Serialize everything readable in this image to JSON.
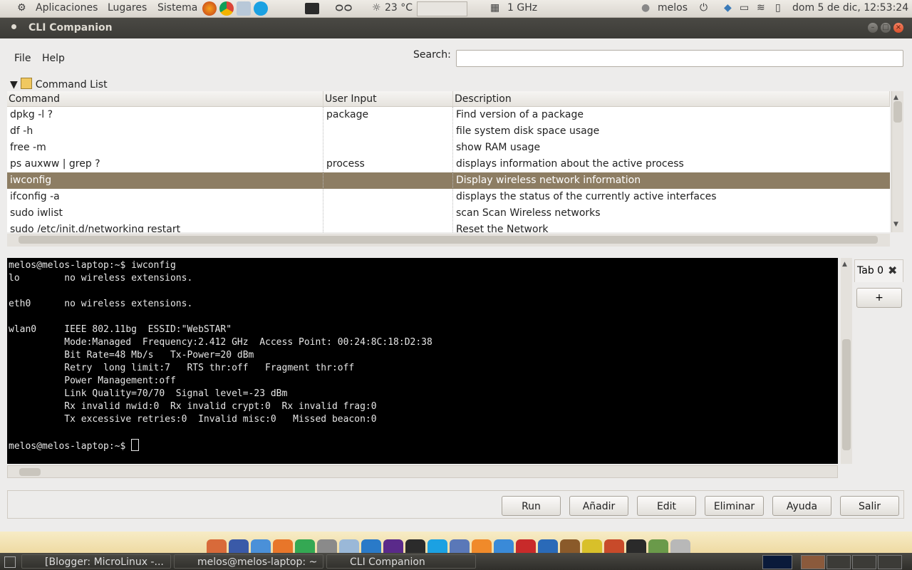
{
  "top_panel": {
    "menus": [
      "Aplicaciones",
      "Lugares",
      "Sistema"
    ],
    "weather": "23 °C",
    "cpu_freq": "1 GHz",
    "user": "melos",
    "datetime": "dom  5 de dic, 12:53:24"
  },
  "window": {
    "title": "CLI Companion",
    "menu": [
      "File",
      "Help"
    ],
    "search": {
      "label": "Search:",
      "value": ""
    },
    "command_list_label": "Command List",
    "table": {
      "headers": [
        "Command",
        "User Input",
        "Description"
      ],
      "rows": [
        {
          "command": "dpkg -l ?",
          "input": "package",
          "description": "Find version of a package"
        },
        {
          "command": "df -h",
          "input": "",
          "description": "file system disk space usage"
        },
        {
          "command": "free -m",
          "input": "",
          "description": "show RAM usage"
        },
        {
          "command": "ps auxww | grep ?",
          "input": "process",
          "description": "displays information about the active process"
        },
        {
          "command": "iwconfig",
          "input": "",
          "description": "Display wireless network information"
        },
        {
          "command": "ifconfig -a",
          "input": "",
          "description": "displays the status of the currently active interfaces"
        },
        {
          "command": "sudo iwlist",
          "input": "",
          "description": "scan Scan Wireless networks"
        },
        {
          "command": "sudo /etc/init.d/networking restart",
          "input": "",
          "description": "Reset the Network"
        }
      ],
      "selected_index": 4
    },
    "terminal": {
      "lines": [
        "melos@melos-laptop:~$ iwconfig",
        "lo        no wireless extensions.",
        "",
        "eth0      no wireless extensions.",
        "",
        "wlan0     IEEE 802.11bg  ESSID:\"WebSTAR\"",
        "          Mode:Managed  Frequency:2.412 GHz  Access Point: 00:24:8C:18:D2:38",
        "          Bit Rate=48 Mb/s   Tx-Power=20 dBm",
        "          Retry  long limit:7   RTS thr:off   Fragment thr:off",
        "          Power Management:off",
        "          Link Quality=70/70  Signal level=-23 dBm",
        "          Rx invalid nwid:0  Rx invalid crypt:0  Rx invalid frag:0",
        "          Tx excessive retries:0  Invalid misc:0   Missed beacon:0",
        "",
        "melos@melos-laptop:~$ "
      ]
    },
    "tabs": {
      "tab0": "Tab 0",
      "add": "+"
    },
    "buttons": [
      "Run",
      "Añadir",
      "Edit",
      "Eliminar",
      "Ayuda",
      "Salir"
    ]
  },
  "taskbar": {
    "tasks": [
      "[Blogger: MicroLinux -...",
      "melos@melos-laptop: ~",
      "CLI Companion"
    ]
  },
  "colors": {
    "selection": "#8d7d63",
    "titlebar": "#3c3b37",
    "terminal_bg": "#000000"
  }
}
